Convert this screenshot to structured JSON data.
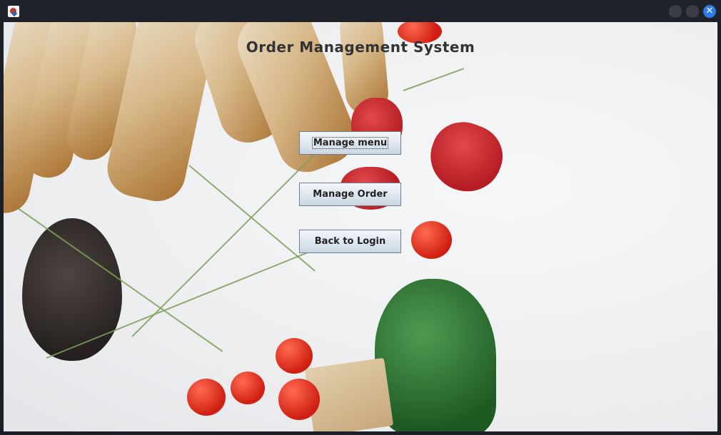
{
  "window": {
    "title": ""
  },
  "title": "Order Management System",
  "buttons": {
    "manage_menu": "Manage menu",
    "manage_order": "Manage Order",
    "back_to_login": "Back to Login"
  },
  "icons": {
    "app": "java-app-icon",
    "close": "close-icon"
  },
  "colors": {
    "titlebar": "#1f222a",
    "close_button": "#2f7be5",
    "button_border": "#6f7c89"
  }
}
